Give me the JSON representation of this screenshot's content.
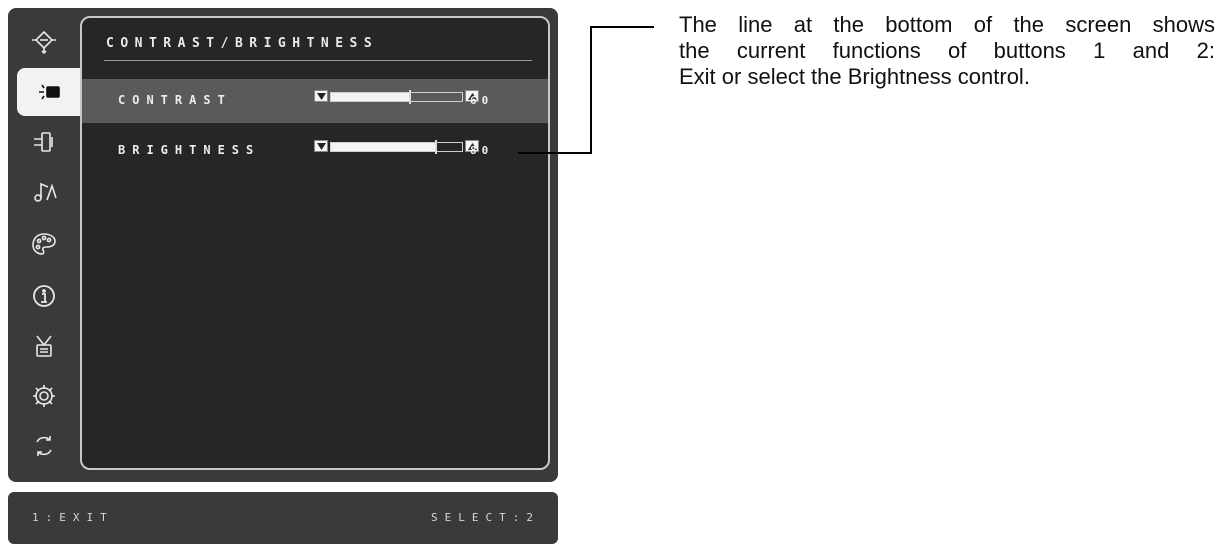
{
  "osd": {
    "title": "CONTRAST/BRIGHTNESS",
    "sidebar_icons": [
      {
        "name": "auto-adjust-icon"
      },
      {
        "name": "contrast-brightness-icon",
        "active": true
      },
      {
        "name": "input-select-icon"
      },
      {
        "name": "audio-icon"
      },
      {
        "name": "color-adjust-icon"
      },
      {
        "name": "information-icon"
      },
      {
        "name": "manual-image-adjust-icon"
      },
      {
        "name": "setup-menu-icon"
      },
      {
        "name": "memory-recall-icon"
      }
    ],
    "rows": [
      {
        "label": "CONTRAST",
        "value": "60",
        "level": 0.6,
        "selected": true
      },
      {
        "label": "BRIGHTNESS",
        "value": "80",
        "level": 0.8,
        "selected": false
      }
    ]
  },
  "bottom_bar": {
    "left": "1:EXIT",
    "right": "SELECT:2"
  },
  "annotation": {
    "lines": [
      "The line at the bottom of the screen shows",
      "the current functions of buttons 1 and 2:",
      "Exit or select the Brightness control."
    ]
  },
  "colors": {
    "osd_background": "#3a3a3a",
    "panel_background": "#262626",
    "selected_row": "#5a5a5a"
  }
}
